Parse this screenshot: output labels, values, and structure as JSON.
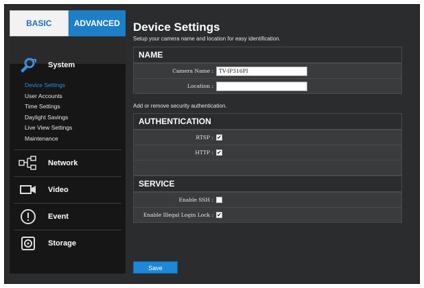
{
  "tabs": {
    "basic": "BASIC",
    "advanced": "ADVANCED"
  },
  "sidebar": {
    "system": {
      "label": "System",
      "items": [
        "Device Settings",
        "User Accounts",
        "Time Settings",
        "Daylight Savings",
        "Live View Settings",
        "Maintenance"
      ]
    },
    "network": "Network",
    "video": "Video",
    "event": "Event",
    "storage": "Storage"
  },
  "main": {
    "title": "Device Settings",
    "subtitle": "Setup your camera name and location for easy identification.",
    "name_panel": {
      "heading": "NAME",
      "camera_name_label": "Camera Name :",
      "camera_name_value": "TV-IP316PI",
      "location_label": "Location :",
      "location_value": ""
    },
    "auth_note": "Add or remove security authentication.",
    "auth_panel": {
      "heading": "AUTHENTICATION",
      "rtsp_label": "RTSP :",
      "rtsp_checked": true,
      "http_label": "HTTP :",
      "http_checked": true
    },
    "service_panel": {
      "heading": "SERVICE",
      "ssh_label": "Enable SSH :",
      "ssh_checked": false,
      "lock_label": "Enable Illegal Login Lock :",
      "lock_checked": true
    },
    "save_label": "Save"
  }
}
